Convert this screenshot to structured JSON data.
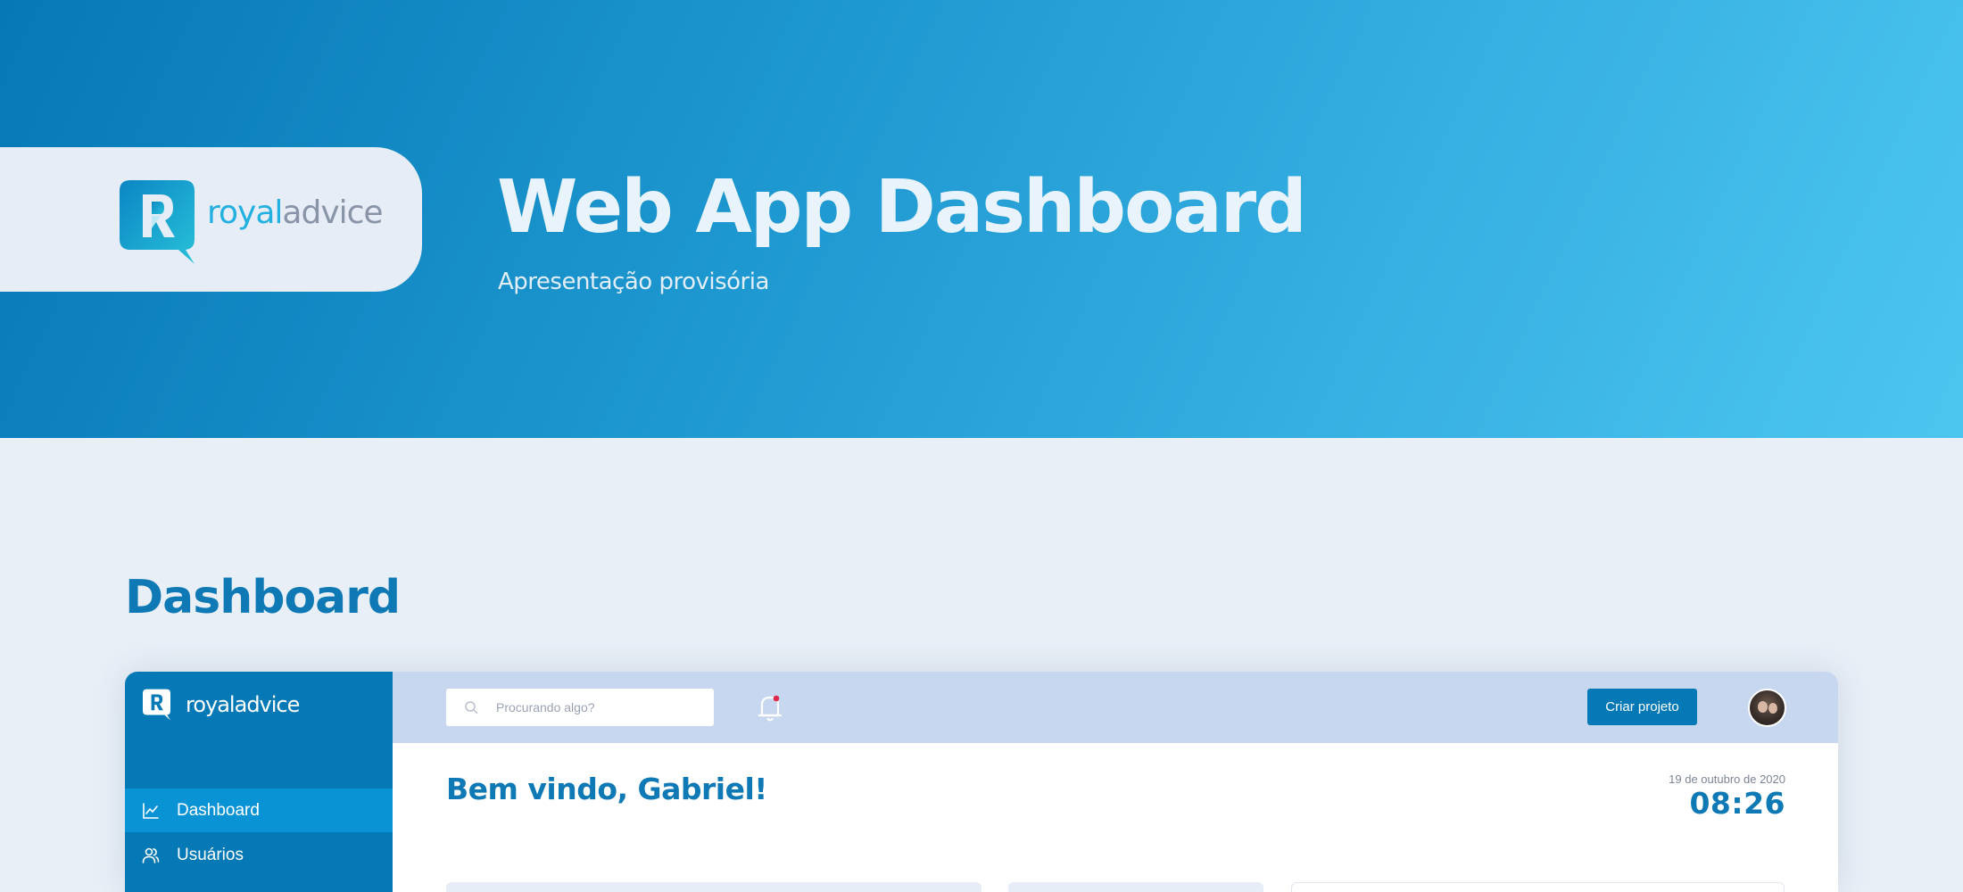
{
  "hero": {
    "brand_part1": "royal",
    "brand_part2": "advice",
    "title": "Web App Dashboard",
    "subtitle": "Apresentação provisória",
    "colors": {
      "gradient_start": "#0678b6",
      "gradient_end": "#4cc6ef",
      "logo_teal": "#22b0e0"
    }
  },
  "section": {
    "heading": "Dashboard"
  },
  "app": {
    "sidebar": {
      "brand_part1": "royal",
      "brand_part2": "advice",
      "items": [
        {
          "label": "Dashboard",
          "icon": "chart-line-icon",
          "active": true
        },
        {
          "label": "Usuários",
          "icon": "users-icon",
          "active": false
        }
      ]
    },
    "topbar": {
      "search_placeholder": "Procurando algo?",
      "search_value": "",
      "notification_unread": true,
      "create_button_label": "Criar projeto",
      "avatar": "user-avatar"
    },
    "main": {
      "welcome": "Bem vindo, Gabriel!",
      "date": "19 de outubro de 2020",
      "time": "08:26"
    },
    "colors": {
      "primary": "#0579b6",
      "sidebar_active": "#0a93d4",
      "topbar_bg": "#c7d7ef"
    }
  }
}
